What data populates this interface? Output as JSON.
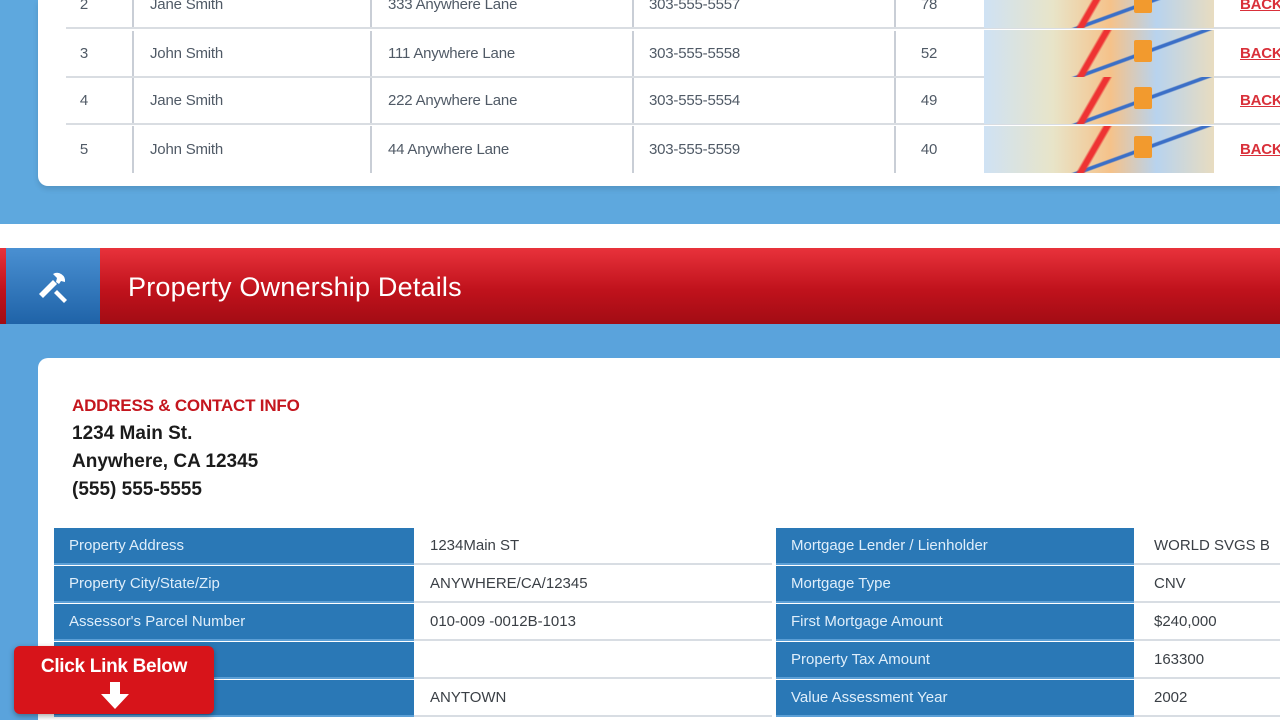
{
  "results": {
    "rows": [
      {
        "num": "2",
        "name": "Jane Smith",
        "address": "333 Anywhere Lane",
        "phone": "303-555-5557",
        "age": "78",
        "link": "BACKGROUND"
      },
      {
        "num": "3",
        "name": "John Smith",
        "address": "111 Anywhere Lane",
        "phone": "303-555-5558",
        "age": "52",
        "link": "BACKGROUND"
      },
      {
        "num": "4",
        "name": "Jane Smith",
        "address": "222 Anywhere Lane",
        "phone": "303-555-5554",
        "age": "49",
        "link": "BACKGROUND"
      },
      {
        "num": "5",
        "name": "John Smith",
        "address": "44 Anywhere Lane",
        "phone": "303-555-5559",
        "age": "40",
        "link": "BACKGROUND"
      }
    ]
  },
  "section": {
    "title": "Property Ownership Details",
    "icon": "tools-icon"
  },
  "contact": {
    "heading": "ADDRESS & CONTACT INFO",
    "line1": "1234 Main St.",
    "line2": "Anywhere, CA 12345",
    "line3": "(555) 555-5555"
  },
  "left_grid": [
    {
      "label": "Property Address",
      "value": "1234Main ST"
    },
    {
      "label": "Property City/State/Zip",
      "value": "ANYWHERE/CA/12345"
    },
    {
      "label": "Assessor's Parcel Number",
      "value": "010-009 -0012B-1013"
    },
    {
      "label": "",
      "value": ""
    },
    {
      "label": "",
      "value": "ANYTOWN"
    }
  ],
  "right_grid": [
    {
      "label": "Mortgage Lender / Lienholder",
      "value": "WORLD SVGS B"
    },
    {
      "label": "Mortgage Type",
      "value": "CNV"
    },
    {
      "label": "First Mortgage Amount",
      "value": "$240,000"
    },
    {
      "label": "Property Tax Amount",
      "value": "163300"
    },
    {
      "label": "Value Assessment Year",
      "value": "2002"
    }
  ],
  "cta": {
    "label": "Click Link Below",
    "icon": "arrow-down-icon"
  },
  "colors": {
    "header_red": "#c0121c",
    "label_blue": "#2a78b6",
    "page_blue": "#5aa3dc",
    "link_red": "#d9303a"
  }
}
